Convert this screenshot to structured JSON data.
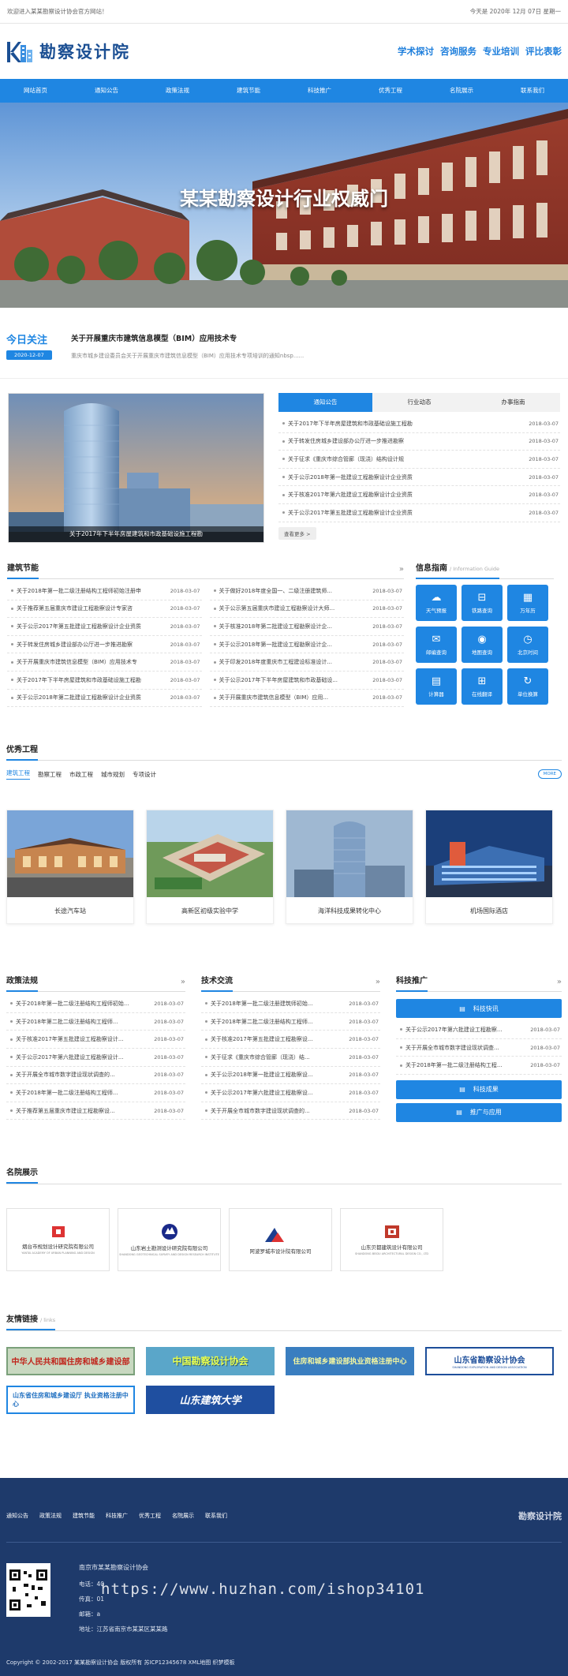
{
  "topbar": {
    "welcome": "欢迎进入某某勘察设计协会官方网站！",
    "date": "今天是 2020年 12月 07日 星期一"
  },
  "header": {
    "logo_text": "勘察设计院",
    "slogans": [
      "学术探讨",
      "咨询服务",
      "专业培训",
      "评比表彰"
    ]
  },
  "nav": [
    "网站首页",
    "通知公告",
    "政策法规",
    "建筑节能",
    "科技推广",
    "优秀工程",
    "名院展示",
    "联系我们"
  ],
  "banner": {
    "title": "某某勘察设计行业权威门"
  },
  "today": {
    "label": "今日关注",
    "date": "2020-12-07",
    "headline": "关于开展重庆市建筑信息模型（BIM）应用技术专",
    "summary": "重庆市城乡建设委员会关于开展重庆市建筑信息模型（BIM）应用技术专项培训的通知nbsp......"
  },
  "feature": {
    "caption": "关于2017年下半年房屋建筑和市政基础设施工程勘",
    "tabs": [
      "通知公告",
      "行业动态",
      "办事指南"
    ],
    "news": [
      {
        "t": "关于2017年下半年房屋建筑和市政基础设施工程勘",
        "d": "2018-03-07"
      },
      {
        "t": "关于转发住房城乡建设部办公厅进一步推进勘察",
        "d": "2018-03-07"
      },
      {
        "t": "关于征求《重庆市综合管廊（现浇）结构设计规",
        "d": "2018-03-07"
      },
      {
        "t": "关于公示2018年第一批建设工程勘察设计企业资质",
        "d": "2018-03-07"
      },
      {
        "t": "关于核准2017年第六批建设工程勘察设计企业资质",
        "d": "2018-03-07"
      },
      {
        "t": "关于公示2017年第五批建设工程勘察设计企业资质",
        "d": "2018-03-07"
      }
    ],
    "more": "查看更多 >"
  },
  "energy": {
    "title": "建筑节能",
    "left": [
      {
        "t": "关于2018年第一批二级注册结构工程师初始注册申",
        "d": "2018-03-07"
      },
      {
        "t": "关于推荐第五届重庆市建设工程勘察设计专家咨",
        "d": "2018-03-07"
      },
      {
        "t": "关于公示2017年第五批建设工程勘察设计企业资质",
        "d": "2018-03-07"
      },
      {
        "t": "关于转发住房城乡建设部办公厅进一步推进勘察",
        "d": "2018-03-07"
      },
      {
        "t": "关于开展重庆市建筑信息模型（BIM）应用技术专",
        "d": "2018-03-07"
      },
      {
        "t": "关于2017年下半年房屋建筑和市政基础设施工程勘",
        "d": "2018-03-07"
      },
      {
        "t": "关于公示2018年第二批建设工程勘察设计企业资质",
        "d": "2018-03-07"
      }
    ],
    "right": [
      {
        "t": "关于做好2018年度全国一、二级注册建筑师...",
        "d": "2018-03-07"
      },
      {
        "t": "关于公示第五届重庆市建设工程勘察设计大师...",
        "d": "2018-03-07"
      },
      {
        "t": "关于核准2018年第二批建设工程勘察设计企...",
        "d": "2018-03-07"
      },
      {
        "t": "关于公示2018年第一批建设工程勘察设计企...",
        "d": "2018-03-07"
      },
      {
        "t": "关于印发2018年度重庆市工程建设标准设计...",
        "d": "2018-03-07"
      },
      {
        "t": "关于公示2017年下半年房屋建筑和市政基础设...",
        "d": "2018-03-07"
      },
      {
        "t": "关于开展重庆市建筑信息模型（BIM）应用...",
        "d": "2018-03-07"
      }
    ]
  },
  "guide": {
    "title": "信息指南",
    "subtitle": "/ Information Guide",
    "items": [
      {
        "label": "天气预报",
        "icon": "☁"
      },
      {
        "label": "铁路查询",
        "icon": "⊟"
      },
      {
        "label": "万年历",
        "icon": "▦"
      },
      {
        "label": "邮编查询",
        "icon": "✉"
      },
      {
        "label": "地图查询",
        "icon": "◉"
      },
      {
        "label": "北京时间",
        "icon": "◷"
      },
      {
        "label": "计算器",
        "icon": "▤"
      },
      {
        "label": "在线翻译",
        "icon": "⊞"
      },
      {
        "label": "单位换算",
        "icon": "↻"
      }
    ]
  },
  "projects": {
    "title": "优秀工程",
    "tabs": [
      "建筑工程",
      "勘察工程",
      "市政工程",
      "城市规划",
      "专项设计"
    ],
    "more": "MORE",
    "items": [
      "长途汽车站",
      "高新区初级实验中学",
      "海洋科技成果转化中心",
      "机场国际酒店"
    ]
  },
  "policy": {
    "title": "政策法规",
    "items": [
      {
        "t": "关于2018年第一批二级注册结构工程师初始...",
        "d": "2018-03-07"
      },
      {
        "t": "关于2018年第二批二级注册结构工程师...",
        "d": "2018-03-07"
      },
      {
        "t": "关于核准2017年第五批建设工程勘察设计...",
        "d": "2018-03-07"
      },
      {
        "t": "关于公示2017年第六批建设工程勘察设计...",
        "d": "2018-03-07"
      },
      {
        "t": "关于开展全市城市数字建设现状调查的...",
        "d": "2018-03-07"
      },
      {
        "t": "关于2018年第一批二级注册结构工程师...",
        "d": "2018-03-07"
      },
      {
        "t": "关于推荐第五届重庆市建设工程勘察设...",
        "d": "2018-03-07"
      }
    ]
  },
  "exchange": {
    "title": "技术交流",
    "items": [
      {
        "t": "关于2018年第一批二级注册建筑师初始...",
        "d": "2018-03-07"
      },
      {
        "t": "关于2018年第二批二级注册结构工程师...",
        "d": "2018-03-07"
      },
      {
        "t": "关于核准2017年第五批建设工程勘察设...",
        "d": "2018-03-07"
      },
      {
        "t": "关于征求《重庆市综合管廊（现浇）结...",
        "d": "2018-03-07"
      },
      {
        "t": "关于公示2018年第一批建设工程勘察设...",
        "d": "2018-03-07"
      },
      {
        "t": "关于公示2017年第六批建设工程勘察设...",
        "d": "2018-03-07"
      },
      {
        "t": "关于开展全市城市数字建设现状调查的...",
        "d": "2018-03-07"
      }
    ]
  },
  "tech": {
    "title": "科技推广",
    "btn1": "科技快讯",
    "items": [
      {
        "t": "关于公示2017年第六批建设工程勘察...",
        "d": "2018-03-07"
      },
      {
        "t": "关于开展全市城市数字建设现状调查...",
        "d": "2018-03-07"
      },
      {
        "t": "关于2018年第一批二级注册结构工程...",
        "d": "2018-03-07"
      }
    ],
    "btn2": "科技成果",
    "btn3": "推广与应用"
  },
  "institutes": {
    "title": "名院展示",
    "items": [
      {
        "name": "烟台市规划设计研究院有限公司",
        "en": "YANTAI ACADEMY OF URBAN PLANNING AND DESIGN"
      },
      {
        "name": "山东岩土勘测设计研究院有限公司",
        "en": "SHANDONG GEOTECHNICAL SURVEY AND DESIGN RESEARCH INSTITUTE"
      },
      {
        "name": "阿波罗城市设计院有限公司",
        "en": "ALGN"
      },
      {
        "name": "山东贝都建筑设计有限公司",
        "en": "SHANDONG BEIDU ARCHITECTURAL DESIGN CO., LTD"
      }
    ]
  },
  "friends": {
    "title": "友情链接",
    "subtitle": "/ links",
    "items": [
      "中华人民共和国住房和城乡建设部",
      "中国勘察设计协会",
      "住房和城乡建设部执业资格注册中心",
      "山东省勘察设计协会",
      "山东省住房和城乡建设厅 执业资格注册中心",
      "山东建筑大学"
    ],
    "sd_en": "SHANDONG EXPLORATION AND DESIGN ASSOCIATION"
  },
  "footer": {
    "nav": [
      "通知公告",
      "政策法规",
      "建筑节能",
      "科技推广",
      "优秀工程",
      "名院展示",
      "联系我们"
    ],
    "logo": "勘察设计院",
    "org": "南京市某某勘察设计协会",
    "lines": [
      "电话：40",
      "传真：01",
      "邮箱：a",
      "地址：江苏省南京市某某区某某路"
    ],
    "watermark": "https://www.huzhan.com/ishop34101",
    "copyright": "Copyright © 2002-2017 某某勘察设计协会 版权所有 苏ICP12345678 XML地图 织梦模板"
  },
  "colors": {
    "accent": "#1f86e2",
    "footer": "#1e3a6b",
    "logo": "#1b4f93"
  }
}
